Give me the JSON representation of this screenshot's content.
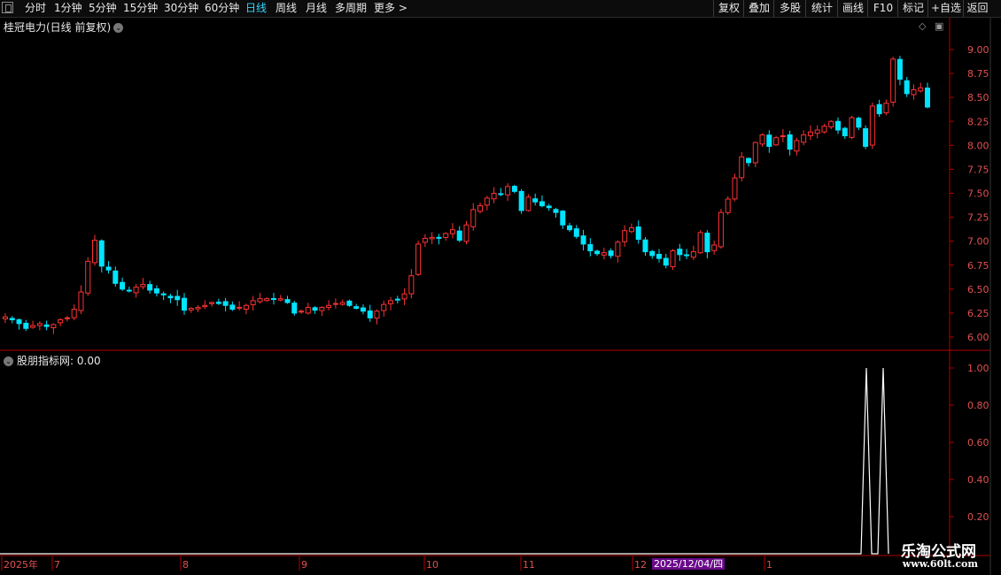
{
  "toolbar": {
    "left_items": [
      "分时",
      "1分钟",
      "5分钟",
      "15分钟",
      "30分钟",
      "60分钟",
      "日线",
      "周线",
      "月线",
      "多周期",
      "更多 >"
    ],
    "active_item": "日线",
    "right_items": [
      "复权",
      "叠加",
      "多股",
      "统计",
      "画线",
      "F10",
      "标记",
      "+自选",
      "返回"
    ]
  },
  "main_chart": {
    "title": "桂冠电力(日线 前复权)",
    "y_ticks": [
      "9.00",
      "8.75",
      "8.50",
      "8.25",
      "8.00",
      "7.75",
      "7.50",
      "7.25",
      "7.00",
      "6.75",
      "6.50",
      "6.25",
      "6.00"
    ]
  },
  "indicator": {
    "title": "股朋指标网",
    "value": ": 0.00",
    "y_ticks": [
      "1.00",
      "0.80",
      "0.60",
      "0.40",
      "0.20"
    ]
  },
  "x_axis": {
    "labels": [
      "2025年",
      "7",
      "8",
      "9",
      "10",
      "11",
      "12",
      "1"
    ],
    "cursor_date": "2025/12/04/四"
  },
  "watermark": {
    "line1": "乐淘公式网",
    "line2": "www.60lt.com"
  },
  "colors": {
    "up": "#ff3232",
    "down": "#00e4ff",
    "axis": "#b00000",
    "background": "#000000"
  },
  "chart_data": {
    "type": "candlestick",
    "ylim": [
      5.95,
      9.12
    ],
    "closes": [
      6.21,
      6.18,
      6.14,
      6.09,
      6.12,
      6.14,
      6.11,
      6.13,
      6.18,
      6.2,
      6.29,
      6.47,
      6.79,
      7.01,
      6.74,
      6.7,
      6.56,
      6.5,
      6.48,
      6.52,
      6.55,
      6.49,
      6.46,
      6.44,
      6.41,
      6.39,
      6.28,
      6.3,
      6.31,
      6.33,
      6.36,
      6.35,
      6.33,
      6.29,
      6.31,
      6.33,
      6.38,
      6.4,
      6.4,
      6.4,
      6.4,
      6.36,
      6.25,
      6.27,
      6.31,
      6.28,
      6.31,
      6.33,
      6.35,
      6.36,
      6.33,
      6.3,
      6.27,
      6.2,
      6.27,
      6.34,
      6.38,
      6.39,
      6.45,
      6.64,
      6.97,
      7.03,
      7.04,
      7.03,
      7.08,
      7.12,
      7.01,
      7.17,
      7.33,
      7.37,
      7.45,
      7.5,
      7.49,
      7.57,
      7.52,
      7.32,
      7.46,
      7.41,
      7.37,
      7.35,
      7.3,
      7.17,
      7.12,
      7.05,
      6.97,
      6.9,
      6.87,
      6.88,
      6.85,
      6.99,
      7.11,
      7.14,
      7.02,
      6.89,
      6.85,
      6.82,
      6.75,
      6.9,
      6.86,
      6.85,
      6.89,
      7.09,
      6.89,
      6.96,
      7.3,
      7.44,
      7.66,
      7.88,
      7.82,
      8.03,
      8.11,
      7.99,
      8.08,
      8.1,
      7.96,
      8.05,
      8.11,
      8.14,
      8.16,
      8.2,
      8.25,
      8.16,
      8.1,
      8.29,
      8.19,
      7.99,
      8.41,
      8.33,
      8.44,
      8.9,
      8.69,
      8.54,
      8.58,
      8.6,
      8.4
    ],
    "indicator_values_shown": [
      1.0,
      1.0
    ]
  }
}
